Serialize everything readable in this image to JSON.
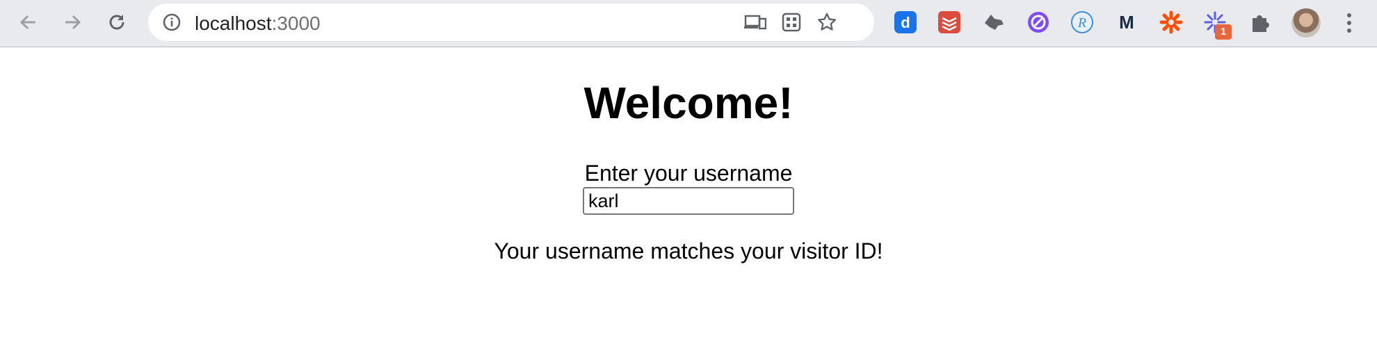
{
  "browser": {
    "url_host": "localhost",
    "url_port": ":3000",
    "extensions": [
      {
        "name": "dayone-icon",
        "color": "#1a73e8",
        "letter": "d"
      },
      {
        "name": "todoist-icon",
        "color": "#db4c3f"
      },
      {
        "name": "wolf-icon",
        "color": "#5f6368"
      },
      {
        "name": "circle-arrow-icon",
        "color": "#7c4dff"
      },
      {
        "name": "r-circle-icon",
        "color": "#3d8fd8",
        "letter": "R"
      },
      {
        "name": "m-logo-icon",
        "color": "#1b2a4a",
        "letter": "M"
      },
      {
        "name": "zapier-icon",
        "color": "#ff4f00"
      },
      {
        "name": "sparkle-icon",
        "color": "#5b5bf0",
        "badge": "1"
      },
      {
        "name": "puzzle-icon",
        "color": "#5f6368"
      }
    ]
  },
  "page": {
    "title": "Welcome!",
    "username_label": "Enter your username",
    "username_value": "karl",
    "status_message": "Your username matches your visitor ID!"
  }
}
